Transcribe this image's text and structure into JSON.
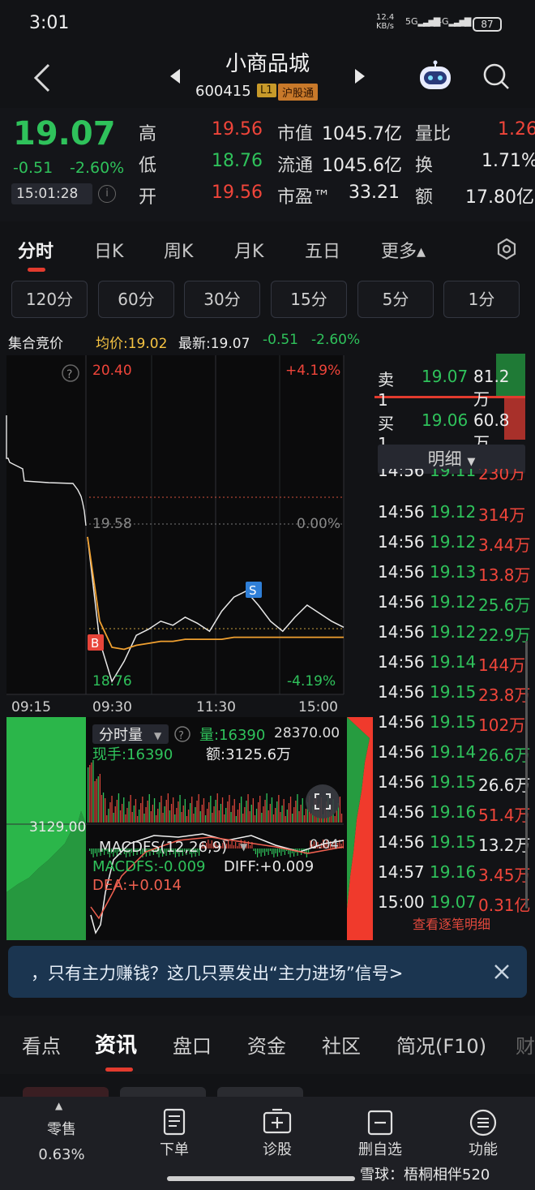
{
  "status": {
    "time": "3:01",
    "net_speed": "12.4",
    "net_unit": "KB/s",
    "sig1": "5G",
    "sig2": "4G",
    "battery": "87"
  },
  "nav": {
    "stock_name": "小商品城",
    "stock_code": "600415",
    "badge_level": "L1",
    "badge_market": "沪股通"
  },
  "quote": {
    "price": "19.07",
    "change": "-0.51",
    "change_pct": "-2.60%",
    "time": "15:01:28",
    "high_label": "高",
    "high": "19.56",
    "low_label": "低",
    "low": "18.76",
    "open_label": "开",
    "open": "19.56",
    "mcap_label": "市值",
    "mcap": "1045.7亿",
    "float_label": "流通",
    "float": "1045.6亿",
    "pe_label": "市盈™",
    "pe": "33.21",
    "vr_label": "量比",
    "vr": "1.26",
    "turn_label": "换",
    "turn": "1.71%",
    "amt_label": "额",
    "amt": "17.80亿"
  },
  "period_tabs": [
    "分时",
    "日K",
    "周K",
    "月K",
    "五日",
    "更多▴"
  ],
  "minute_buttons": [
    "120分",
    "60分",
    "30分",
    "15分",
    "5分",
    "1分"
  ],
  "chart_info": {
    "auction": "集合竞价",
    "avg": "均价:19.02",
    "latest": "最新:19.07",
    "chg": "-0.51",
    "pct": "-2.60%"
  },
  "chart_labels": {
    "top_price": "20.40",
    "top_pct": "+4.19%",
    "mid_price": "19.58",
    "mid_pct": "0.00%",
    "bottom_price": "18.76",
    "bottom_pct": "-4.19%",
    "time_ticks": [
      "09:15",
      "09:30",
      "11:30",
      "15:00"
    ],
    "marker_b": "B",
    "marker_s": "S",
    "vol_title": "分时量",
    "vol_qty": "量:16390",
    "vol_max": "28370.00",
    "vol_now": "现手:16390",
    "vol_amt": "额:3125.6万",
    "auction_vol": "3129.00",
    "macd_title": "MACDFS(12,26,9)",
    "macd_val": "0.04",
    "macdfs": "MACDFS:-0.009",
    "diff": "DIFF:+0.009",
    "dea": "DEA:+0.014"
  },
  "chart_data": {
    "type": "line",
    "x_ticks": [
      "09:30",
      "11:30",
      "15:00"
    ],
    "ylim": [
      18.76,
      20.4
    ],
    "pre_close": 19.58,
    "series": [
      {
        "values": [
          19.52,
          19.0,
          18.8,
          18.9,
          19.03,
          19.06,
          19.1,
          19.08,
          19.12,
          19.09,
          19.05,
          19.15,
          19.22,
          19.25,
          19.18,
          19.1,
          19.05,
          19.12,
          19.18,
          19.14,
          19.1,
          19.07
        ]
      },
      {
        "values": [
          19.52,
          19.1,
          18.97,
          18.96,
          18.98,
          18.99,
          19.0,
          19.0,
          19.01,
          19.01,
          19.01,
          19.01,
          19.02,
          19.02,
          19.02,
          19.02,
          19.02,
          19.02,
          19.02,
          19.02,
          19.02,
          19.02
        ]
      }
    ]
  },
  "orderbook": {
    "sell_label": "卖1",
    "sell_price": "19.07",
    "sell_vol": "81.2万",
    "buy_label": "买1",
    "buy_price": "19.06",
    "buy_vol": "60.8万",
    "detail_tab": "明细",
    "ticks": [
      {
        "t": "14:56",
        "p": "19.11",
        "v": "230万",
        "pc": "green",
        "vc": "red"
      },
      {
        "t": "14:56",
        "p": "19.12",
        "v": "314万",
        "pc": "green",
        "vc": "red"
      },
      {
        "t": "14:56",
        "p": "19.12",
        "v": "3.44万",
        "pc": "green",
        "vc": "red"
      },
      {
        "t": "14:56",
        "p": "19.13",
        "v": "13.8万",
        "pc": "green",
        "vc": "red"
      },
      {
        "t": "14:56",
        "p": "19.12",
        "v": "25.6万",
        "pc": "green",
        "vc": "green"
      },
      {
        "t": "14:56",
        "p": "19.12",
        "v": "22.9万",
        "pc": "green",
        "vc": "green"
      },
      {
        "t": "14:56",
        "p": "19.14",
        "v": "144万",
        "pc": "green",
        "vc": "red"
      },
      {
        "t": "14:56",
        "p": "19.15",
        "v": "23.8万",
        "pc": "green",
        "vc": "red"
      },
      {
        "t": "14:56",
        "p": "19.15",
        "v": "102万",
        "pc": "green",
        "vc": "red"
      },
      {
        "t": "14:56",
        "p": "19.14",
        "v": "26.6万",
        "pc": "green",
        "vc": "green"
      },
      {
        "t": "14:56",
        "p": "19.15",
        "v": "26.6万",
        "pc": "green",
        "vc": "white"
      },
      {
        "t": "14:56",
        "p": "19.16",
        "v": "51.4万",
        "pc": "green",
        "vc": "red"
      },
      {
        "t": "14:56",
        "p": "19.15",
        "v": "13.2万",
        "pc": "green",
        "vc": "white"
      },
      {
        "t": "14:57",
        "p": "19.16",
        "v": "3.45万",
        "pc": "green",
        "vc": "red"
      },
      {
        "t": "15:00",
        "p": "19.07",
        "v": "0.31亿",
        "pc": "green",
        "vc": "red"
      }
    ],
    "view_all": "查看逐笔明细"
  },
  "banner": {
    "text": "，只有主力赚钱？这几只票发出“主力进场”信号>"
  },
  "info_tabs": [
    "看点",
    "资讯",
    "盘口",
    "资金",
    "社区",
    "简况(F10)",
    "财"
  ],
  "bottom_bar": {
    "retail_label": "零售",
    "retail_value": "0.63%",
    "order_label": "下单",
    "diagnose_label": "诊股",
    "remove_label": "删自选",
    "func_label": "功能"
  },
  "watermark": "雪球：梧桐相伴520",
  "colors": {
    "up": "#f0453a",
    "down": "#2fc25b",
    "avg_line": "#f0a030",
    "bg": "#121316"
  }
}
